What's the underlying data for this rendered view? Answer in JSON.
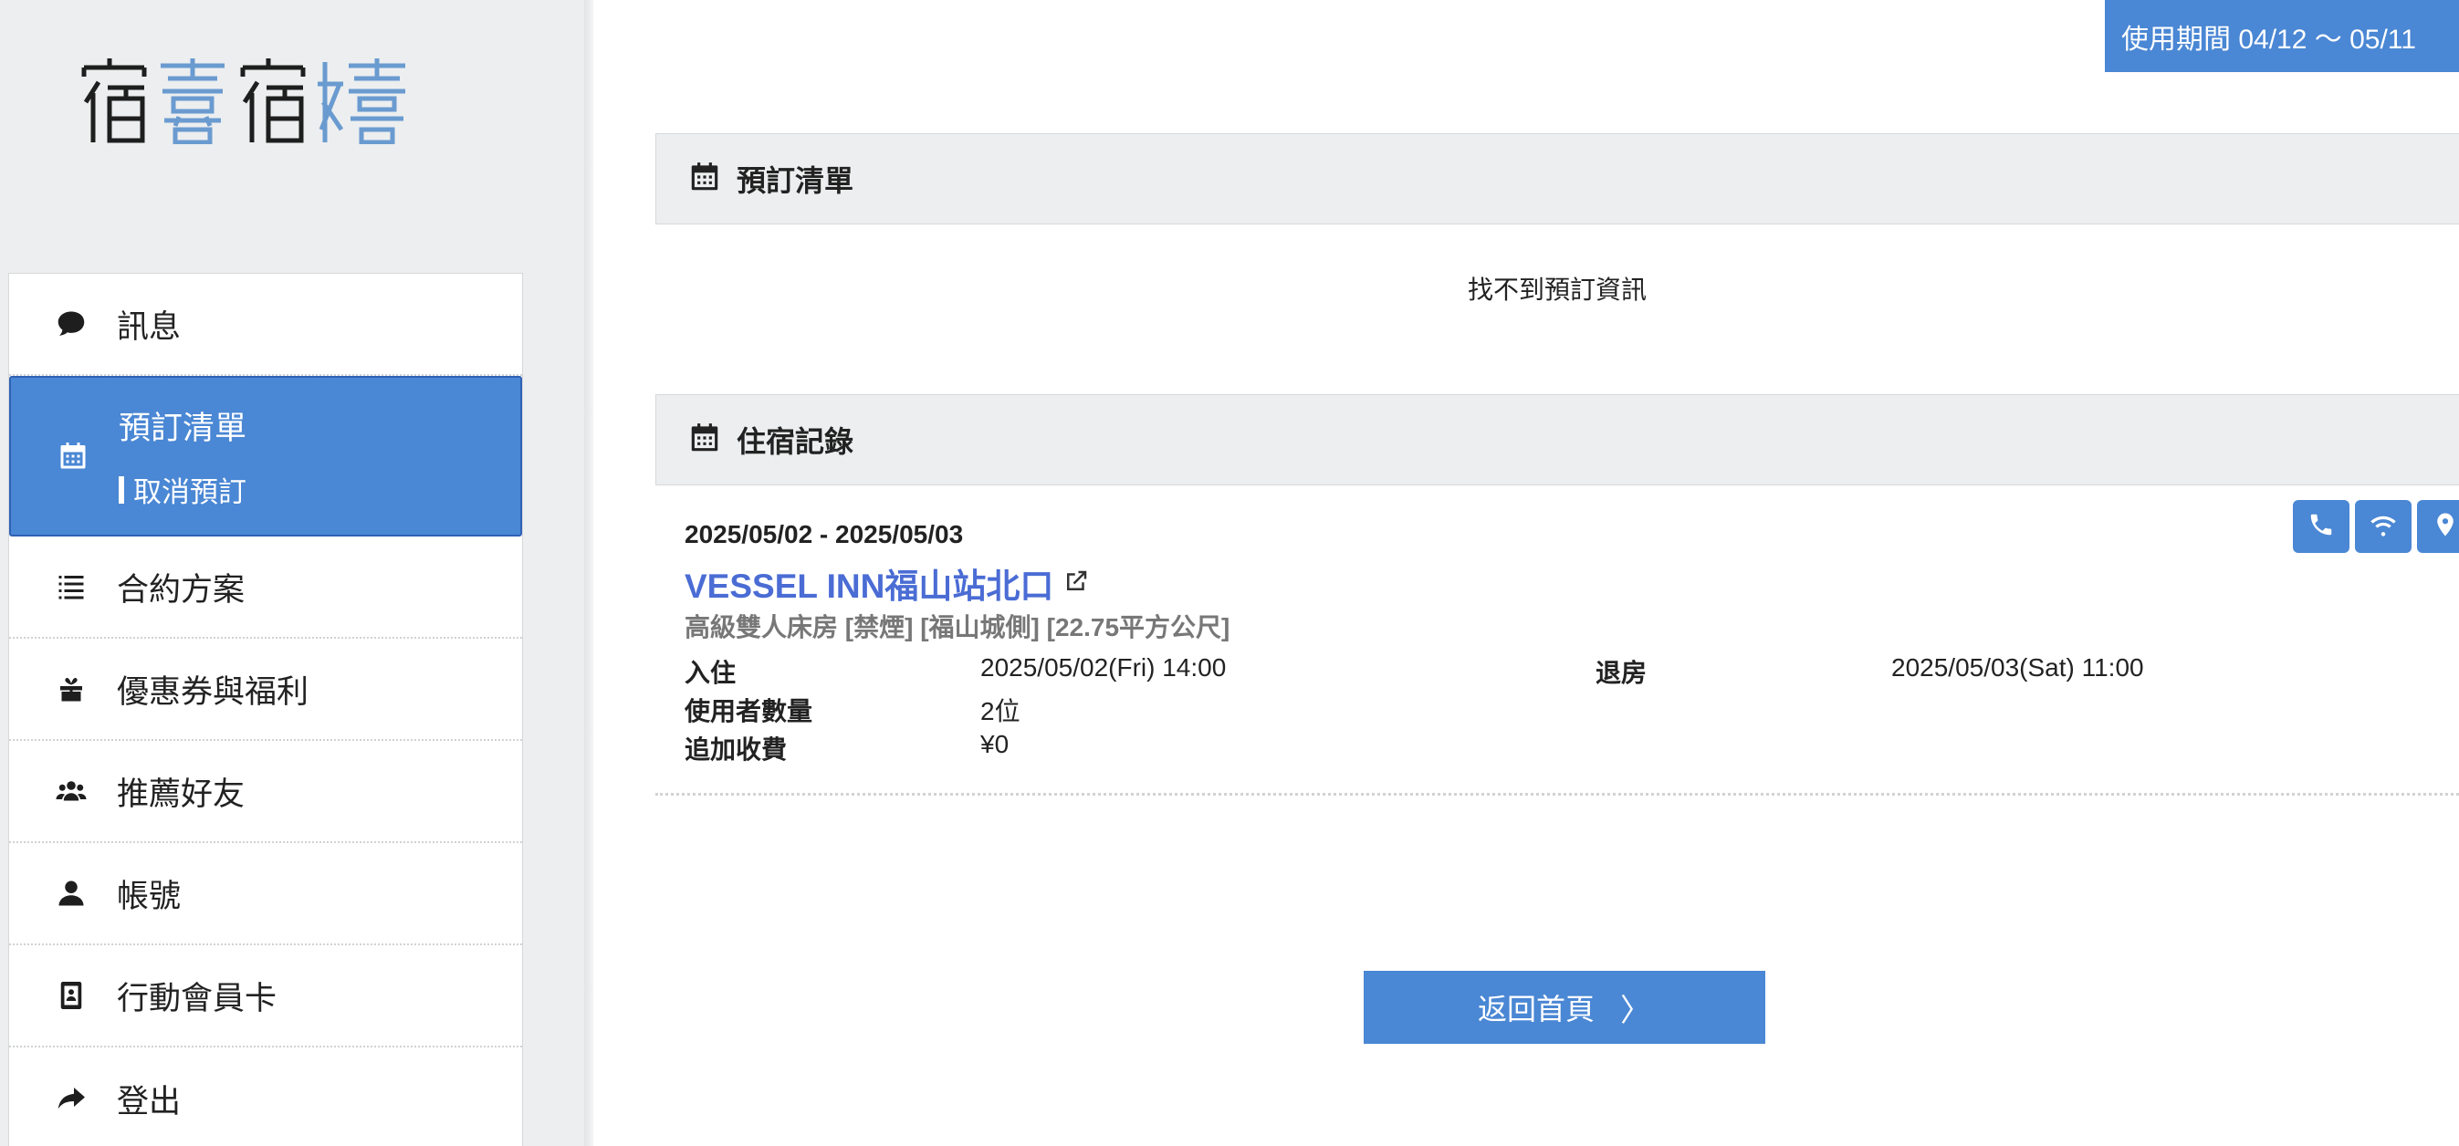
{
  "logo": {
    "alt": "宿喜宿嬉"
  },
  "sidebar": {
    "items": [
      {
        "label": "訊息",
        "icon": "chat-bubble-icon"
      },
      {
        "label": "預訂清單",
        "icon": "calendar-icon",
        "sub_label": "取消預訂",
        "active": true
      },
      {
        "label": "合約方案",
        "icon": "list-icon"
      },
      {
        "label": "優惠券與福利",
        "icon": "gift-icon"
      },
      {
        "label": "推薦好友",
        "icon": "users-icon"
      },
      {
        "label": "帳號",
        "icon": "user-icon"
      },
      {
        "label": "行動會員卡",
        "icon": "member-card-icon"
      },
      {
        "label": "登出",
        "icon": "share-arrow-icon"
      }
    ]
  },
  "header": {
    "period": "使用期間 04/12 〜 05/11"
  },
  "reservations": {
    "title": "預訂清單",
    "empty_message": "找不到預訂資訊"
  },
  "history": {
    "title": "住宿記錄",
    "records": [
      {
        "dates": "2025/05/02 - 2025/05/03",
        "hotel": "VESSEL INN福山站北口",
        "room": "高級雙人床房 [禁煙] [福山城側] [22.75平方公尺]",
        "checkin_label": "入住",
        "checkin": "2025/05/02(Fri) 14:00",
        "checkout_label": "退房",
        "checkout": "2025/05/03(Sat) 11:00",
        "guests_label": "使用者數量",
        "guests": "2位",
        "fee_label": "追加收費",
        "fee": "¥0"
      }
    ]
  },
  "home_button": {
    "label": "返回首頁",
    "chevron": "〉"
  },
  "colors": {
    "accent": "#4a87d4",
    "link": "#4a6cd4",
    "sidebar_bg": "#eceeef"
  }
}
